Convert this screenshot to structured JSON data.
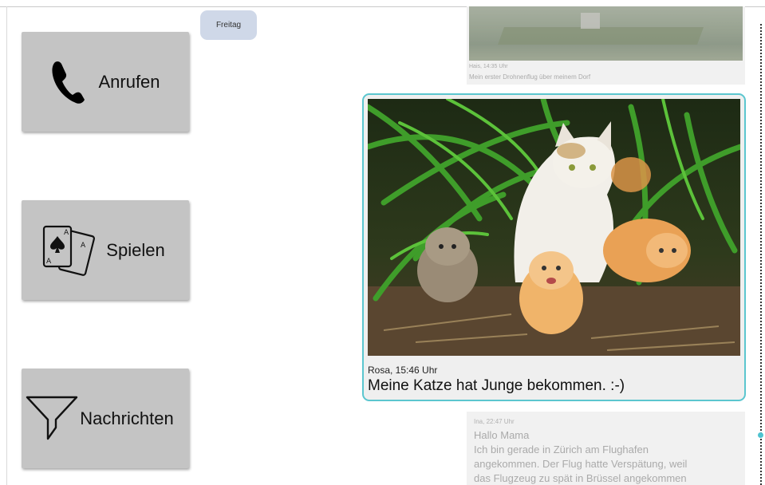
{
  "sidebar": {
    "call_label": "Anrufen",
    "play_label": "Spielen",
    "messages_label": "Nachrichten",
    "icons": {
      "call": "phone-icon",
      "play": "playing-cards-icon",
      "messages": "filter-icon"
    }
  },
  "chat": {
    "day_badge": "Freitag",
    "messages": [
      {
        "meta": "Hais, 14:35 Uhr",
        "text": "Mein erster Drohnenflug über meinem Dorf",
        "has_photo": true
      },
      {
        "meta": "Rosa, 15:46 Uhr",
        "text": "Meine Katze hat Junge bekommen. :-)",
        "has_photo": true,
        "selected": true
      },
      {
        "meta": "Ina, 22:47 Uhr",
        "lines": [
          "Hallo Mama",
          "Ich bin gerade in Zürich am Flughafen",
          "angekommen. Der Flug hatte Verspätung, weil",
          "das Flugzeug zu spät in Brüssel angekommen"
        ]
      }
    ]
  },
  "colors": {
    "button_bg": "#c4c4c4",
    "badge_bg": "#cfd8e8",
    "selected_border": "#5bc6cf",
    "scroll_thumb": "#4fc3d0"
  }
}
